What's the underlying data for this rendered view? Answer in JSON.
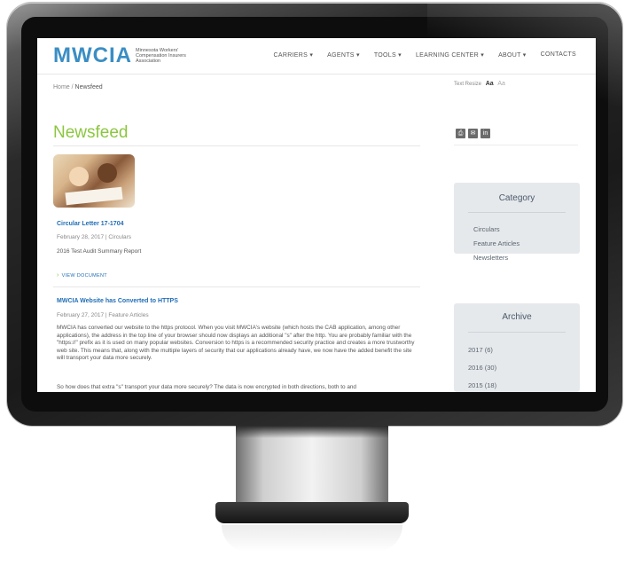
{
  "site": {
    "logo_text": "MWCIA",
    "logo_tagline": "Minnesota Workers' Compensation Insurers Association",
    "nav": [
      "CARRIERS ▾",
      "AGENTS ▾",
      "TOOLS ▾",
      "LEARNING CENTER ▾",
      "ABOUT ▾",
      "CONTACTS"
    ]
  },
  "breadcrumb": {
    "home": "Home",
    "sep": "/",
    "current": "Newsfeed"
  },
  "text_resize": {
    "label": "Text Resize",
    "large": "Aa",
    "small": "Aa"
  },
  "page": {
    "title": "Newsfeed"
  },
  "share": [
    "print-icon",
    "email-icon",
    "linkedin-icon"
  ],
  "posts": [
    {
      "title": "Circular Letter 17-1704",
      "meta": "February 28, 2017 | Circulars",
      "summary": "2016 Test Audit Summary Report",
      "link": "VIEW DOCUMENT"
    },
    {
      "title": "MWCIA Website has Converted to HTTPS",
      "meta": "February 27, 2017 | Feature Articles",
      "body": "MWCIA has converted our website to the https protocol.  When you visit MWCIA's website (which hosts the CAB application, among other applications), the address in the top line of your browser should now displays an additional \"s\" after the http.  You are probably familiar with the \"https://\" prefix as it is used on many popular websites.  Conversion to https is a recommended security practice and creates a more trustworthy web site. This means that, along with the multiple layers of security that our applications already have, we now have the added benefit the site will transport your data more securely.",
      "body2": "So how does that extra \"s\" transport your data more securely?  The data is now encrypted in both directions, both to and"
    }
  ],
  "sidebar": {
    "category": {
      "title": "Category",
      "items": [
        "Circulars",
        "Feature Articles",
        "Newsletters"
      ]
    },
    "archive": {
      "title": "Archive",
      "items": [
        "2017 (6)",
        "2016 (30)",
        "2015 (18)"
      ]
    }
  }
}
